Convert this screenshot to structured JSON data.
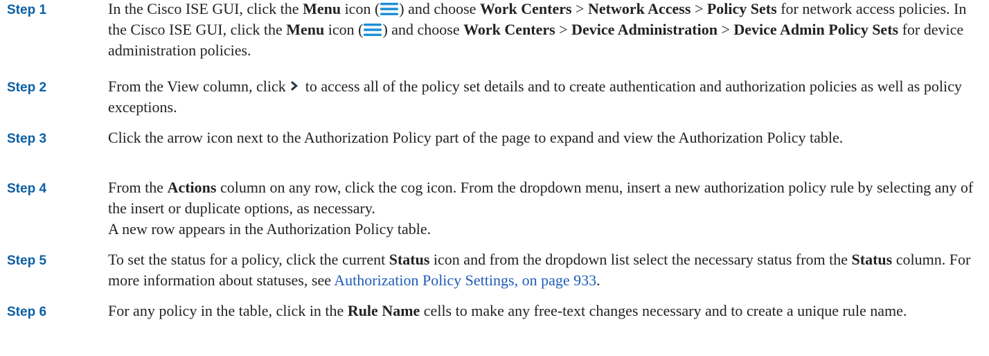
{
  "steps": [
    {
      "label": "Step 1",
      "s1": {
        "t1": "In the Cisco ISE GUI, click the ",
        "b1": "Menu",
        "t2": " icon (",
        "t3": ") and choose ",
        "b2": "Work Centers",
        "t4": " > ",
        "b3": "Network Access",
        "t5": " > ",
        "b4": "Policy Sets",
        "t6": " for network access policies. In the Cisco ISE GUI, click the ",
        "b5": "Menu",
        "t7": " icon (",
        "t8": ") and choose ",
        "b6": "Work Centers",
        "t9": " > ",
        "b7": "Device Administration",
        "t10": " > ",
        "b8": "Device Admin Policy Sets",
        "t11": " for device administration policies."
      }
    },
    {
      "label": "Step 2",
      "s2": {
        "t1": "From the View column, click",
        "t2": "to access all of the policy set details and to create authentication and authorization policies as well as policy exceptions."
      }
    },
    {
      "label": "Step 3",
      "s3": {
        "t1": "Click the arrow icon next to the Authorization Policy part of the page to expand and view the Authorization Policy table."
      }
    },
    {
      "label": "Step 4",
      "s4": {
        "t1": "From the ",
        "b1": "Actions",
        "t2": " column on any row, click the cog icon. From the dropdown menu, insert a new authorization policy rule by selecting any of the insert or duplicate options, as necessary.",
        "note": "A new row appears in the Authorization Policy table."
      }
    },
    {
      "label": "Step 5",
      "s5": {
        "t1": "To set the status for a policy, click the current ",
        "b1": "Status",
        "t2": " icon and from the dropdown list select the necessary status from the ",
        "b2": "Status",
        "t3": " column. For more information about statuses, see ",
        "link": "Authorization Policy Settings, on page 933",
        "t4": "."
      }
    },
    {
      "label": "Step 6",
      "s6": {
        "t1": "For any policy in the table, click in the ",
        "b1": "Rule Name",
        "t2": " cells to make any free-text changes necessary and to create a unique rule name."
      }
    }
  ],
  "colors": {
    "step_label": "#0b5fa5",
    "link": "#1e5bb8",
    "menu_icon": "#1b8fd6",
    "chevron_bg": "#2b3a4a"
  },
  "icons": [
    "menu-icon",
    "chevron-right-icon"
  ]
}
